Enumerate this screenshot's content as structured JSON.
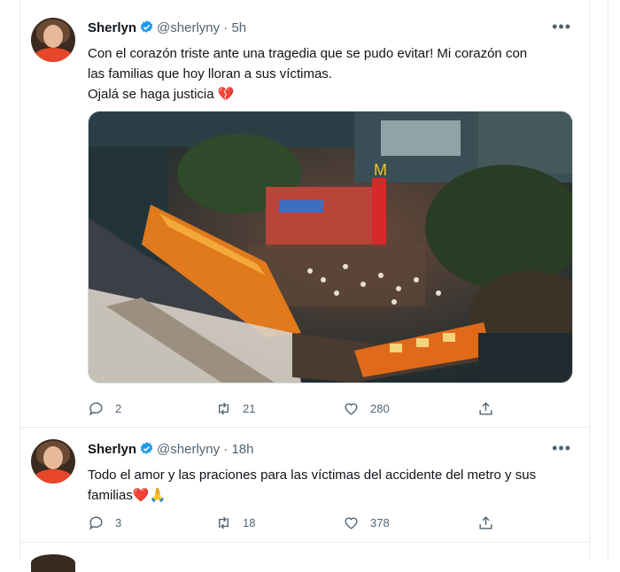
{
  "tweets": [
    {
      "name": "Sherlyn",
      "handle": "@sherlyny",
      "separator": "·",
      "time": "5h",
      "text_line1": "Con el corazón triste ante una tragedia que se pudo evitar! Mi corazón con",
      "text_line2": "las familias que hoy lloran a sus víctimas.",
      "text_line3": "Ojalá se haga justicia 💔",
      "replies": "2",
      "retweets": "21",
      "likes": "280"
    },
    {
      "name": "Sherlyn",
      "handle": "@sherlyny",
      "separator": "·",
      "time": "18h",
      "text_line1": "Todo el amor y las praciones para las víctimas del accidente del metro  y sus",
      "text_line2": "familias❤️🙏",
      "replies": "3",
      "retweets": "18",
      "likes": "378"
    }
  ],
  "icons": {
    "verified": "verified-badge-icon",
    "more": "more-icon",
    "reply": "reply-icon",
    "retweet": "retweet-icon",
    "like": "heart-icon",
    "share": "share-icon"
  },
  "colors": {
    "verified": "#1d9bf0",
    "muted": "#536471",
    "border": "#e6ecf0"
  }
}
